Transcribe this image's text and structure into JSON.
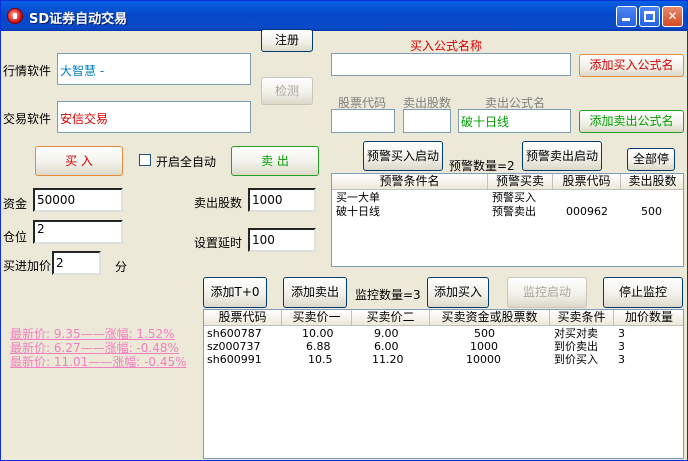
{
  "window": {
    "title": "SD证券自动交易"
  },
  "labels": {
    "quote_software": "行情软件",
    "trade_software": "交易软件",
    "buy_formula_name": "买入公式名称",
    "stock_code": "股票代码",
    "sell_shares": "卖出股数",
    "sell_formula_name": "卖出公式名",
    "capital": "资金",
    "position": "仓位",
    "buy_add_price": "买进加价",
    "minute_unit": "分",
    "sell_shares2": "卖出股数",
    "set_delay": "设置延时",
    "alert_count": "预警数量=2",
    "monitor_count": "监控数量=3",
    "auto_all": "开启全自动"
  },
  "fields": {
    "quote_software": "大智慧 -",
    "trade_software": "安信交易",
    "buy_formula": "",
    "stock_code": "",
    "sell_shares": "",
    "sell_formula": "破十日线",
    "capital": "50000",
    "position": "2",
    "buy_add_price": "2",
    "sell_shares2": "1000",
    "set_delay": "100"
  },
  "buttons": {
    "register": "注册",
    "detect": "检测",
    "add_buy_formula": "添加买入公式名",
    "add_sell_formula": "添加卖出公式名",
    "buy": "买 入",
    "sell": "卖 出",
    "alert_buy_start": "预警买入启动",
    "alert_sell_start": "预警卖出启动",
    "stop_all": "全部停",
    "add_t0": "添加T+0",
    "add_sell": "添加卖出",
    "add_buy": "添加买入",
    "monitor_start": "监控启动",
    "stop_monitor": "停止监控"
  },
  "alert_table": {
    "columns": [
      "预警条件名",
      "预警买卖",
      "股票代码",
      "卖出股数"
    ],
    "rows": [
      [
        "买一大单",
        "预警买入",
        "",
        ""
      ],
      [
        "破十日线",
        "预警卖出",
        "000962",
        "500"
      ]
    ]
  },
  "monitor_table": {
    "columns": [
      "股票代码",
      "买卖价一",
      "买卖价二",
      "买卖资金或股票数",
      "买卖条件",
      "加价数量"
    ],
    "rows": [
      [
        "sh600787",
        "10.00",
        "9.00",
        "500",
        "对买对卖",
        "3"
      ],
      [
        "sz000737",
        "6.88",
        "6.00",
        "1000",
        "到价卖出",
        "3"
      ],
      [
        "sh600991",
        "10.5",
        "11.20",
        "10000",
        "到价买入",
        "3"
      ]
    ]
  },
  "price_lines": [
    "最新价: 9.35——涨幅: 1.52%",
    "最新价: 6.27——涨幅: -0.48%",
    "最新价: 11.01——涨幅: -0.45%"
  ]
}
